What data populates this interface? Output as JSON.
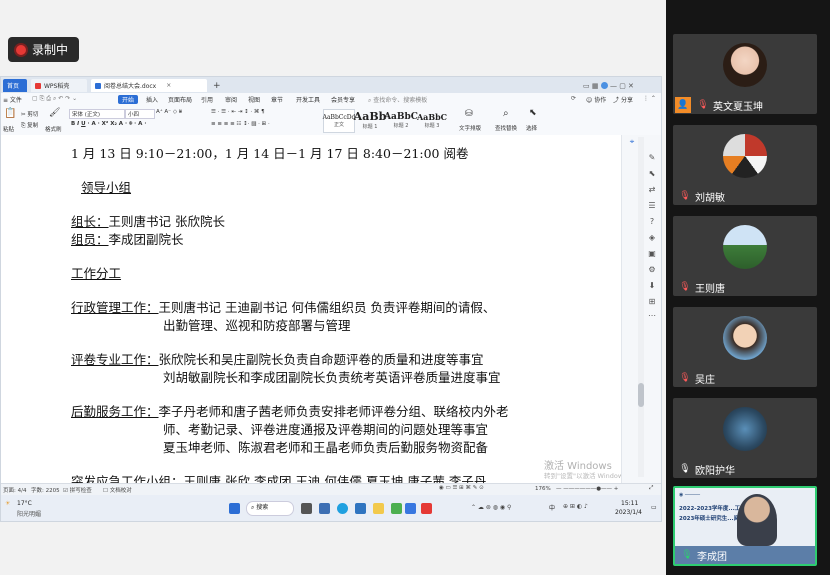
{
  "recording": {
    "label": "录制中"
  },
  "app": {
    "tabs": [
      {
        "label": "首页"
      },
      {
        "label": "WPS稻壳"
      },
      {
        "label": "阅卷总结大会.docx"
      }
    ],
    "new_tab": "+",
    "menus": [
      {
        "label": "≡ 文件"
      },
      {
        "label": "开始"
      },
      {
        "label": "插入"
      },
      {
        "label": "页面布局"
      },
      {
        "label": "引用"
      },
      {
        "label": "审阅"
      },
      {
        "label": "视图"
      },
      {
        "label": "章节"
      },
      {
        "label": "开发工具"
      },
      {
        "label": "会员专享"
      },
      {
        "label": "查找命令、搜索模板"
      }
    ],
    "menu_right": {
      "collab": "协作",
      "share": "分享"
    },
    "ribbon": {
      "paste": "粘贴",
      "cut": "剪切",
      "copy": "复制",
      "format_painter": "格式刷",
      "font_name": "宋体 (正文)",
      "font_size": "小四",
      "styles": [
        {
          "sample": "AaBbCcDd",
          "name": "正文"
        },
        {
          "sample": "AaBb",
          "name": "标题 1"
        },
        {
          "sample": "AaBbC",
          "name": "标题 2"
        },
        {
          "sample": "AaBbC",
          "name": "标题 3"
        }
      ],
      "text_tools": "文字排版",
      "find_replace": "查找替换",
      "select": "选择"
    },
    "document": {
      "lines": [
        "1 月 13 日 9:10－21:00，1 月 14 日－1 月 17 日 8:40－21:00 阅卷",
        "领导小组",
        "组长：",
        "王则唐书记  张欣院长",
        "组员：",
        "李成团副院长",
        "工作分工",
        "行政管理工作：",
        "王则唐书记  王迪副书记  何伟儒组织员  负责评卷期间的请假、",
        "出勤管理、巡视和防疫部署与管理",
        "评卷专业工作：",
        "张欣院长和吴庄副院长负责自命题评卷的质量和进度等事宜",
        "刘胡敏副院长和李成团副院长负责统考英语评卷质量进度事宜",
        "后勤服务工作：",
        "李子丹老师和唐子茜老师负责安排老师评卷分组、联络校内外老",
        "师、考勤记录、评卷进度通报及评卷期间的问题处理等事宜",
        "夏玉坤老师、陈淑君老师和王晶老师负责后勤服务物资配备",
        "突发应急工作小组：",
        "王则唐  张欣  李成团  王迪  何伟儒  夏玉坤  唐子茜  李子丹"
      ],
      "watermark_title": "激活 Windows",
      "watermark_sub": "转到\"设置\"以激活 Windows。"
    },
    "status": {
      "page": "页面: 4/4",
      "words": "字数: 2205",
      "spell": "拼写检查",
      "proof": "文档校对",
      "zoom": "176%"
    },
    "taskbar": {
      "weather_temp": "17°C",
      "weather_desc": "阳光明媚",
      "search": "搜索",
      "time": "15:11",
      "date": "2023/1/4",
      "ime": "中"
    }
  },
  "participants": [
    {
      "name": "英文夏玉坤",
      "mic": "muted"
    },
    {
      "name": "刘胡敏",
      "mic": "muted"
    },
    {
      "name": "王则唐",
      "mic": "muted"
    },
    {
      "name": "吴庄",
      "mic": "muted"
    },
    {
      "name": "欧阳护华",
      "mic": "on"
    },
    {
      "name": "李成团",
      "mic": "on",
      "banner_line1": "2022-2023学年度...工作总结会暨",
      "banner_line2": "2023年硕士研究生...阅卷工作动员会"
    }
  ],
  "colors": {
    "accent": "#2c6ed5",
    "active_speaker": "#2ecc71",
    "record": "#e53935"
  }
}
